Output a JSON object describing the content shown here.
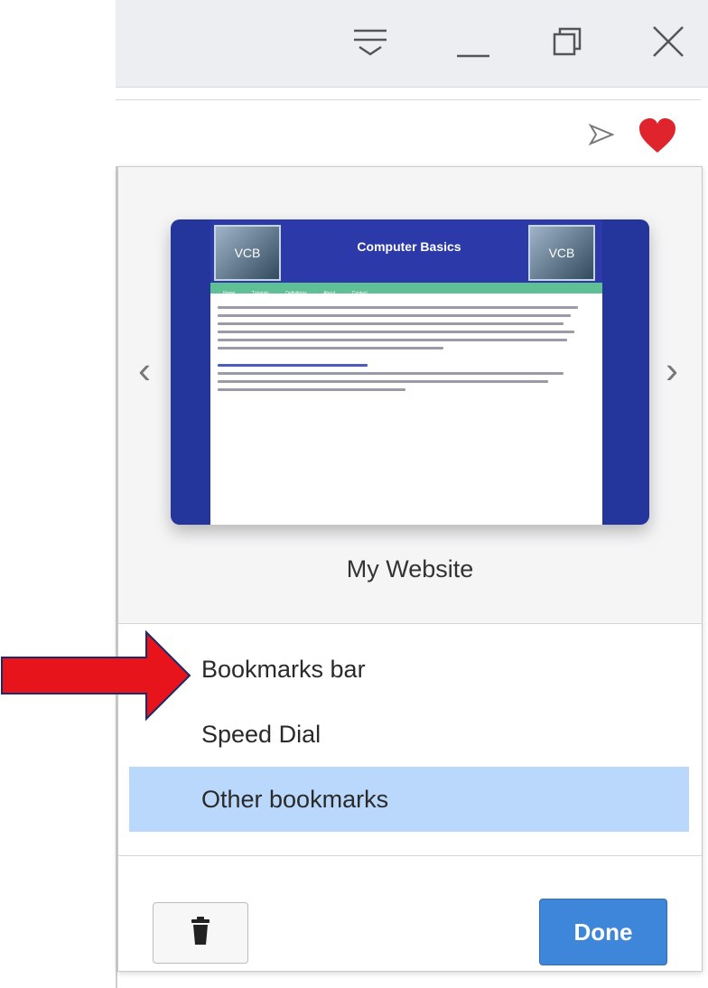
{
  "colors": {
    "titlebar_bg": "#eceef2",
    "selected_row": "#b9d8fb",
    "done_button": "#3e86d9",
    "heart": "#e0242e",
    "annotation_arrow": "#e8141b",
    "thumbnail_frame": "#24359c",
    "thumbnail_nav": "#5fbf95"
  },
  "titlebar": {
    "icons": [
      "easy-setup-menu-icon",
      "minimize-icon",
      "restore-icon",
      "close-icon"
    ]
  },
  "addressbar": {
    "icons": [
      "send-icon",
      "heart-bookmark-icon"
    ]
  },
  "bookmark_popup": {
    "preview": {
      "title": "My Website",
      "thumbnail": {
        "site_heading": "Computer Basics",
        "nav_links": [
          "Home",
          "Tutorials",
          "Definitions",
          "About",
          "Contact"
        ],
        "logo_text": "VCB"
      },
      "prev_icon": "chevron-left-icon",
      "next_icon": "chevron-right-icon"
    },
    "folders": [
      {
        "label": "Bookmarks bar",
        "selected": false
      },
      {
        "label": "Speed Dial",
        "selected": false
      },
      {
        "label": "Other bookmarks",
        "selected": true
      }
    ],
    "delete_icon": "trash-icon",
    "done_label": "Done"
  },
  "annotation": {
    "icon": "red-arrow-icon",
    "points_to": "Bookmarks bar"
  }
}
